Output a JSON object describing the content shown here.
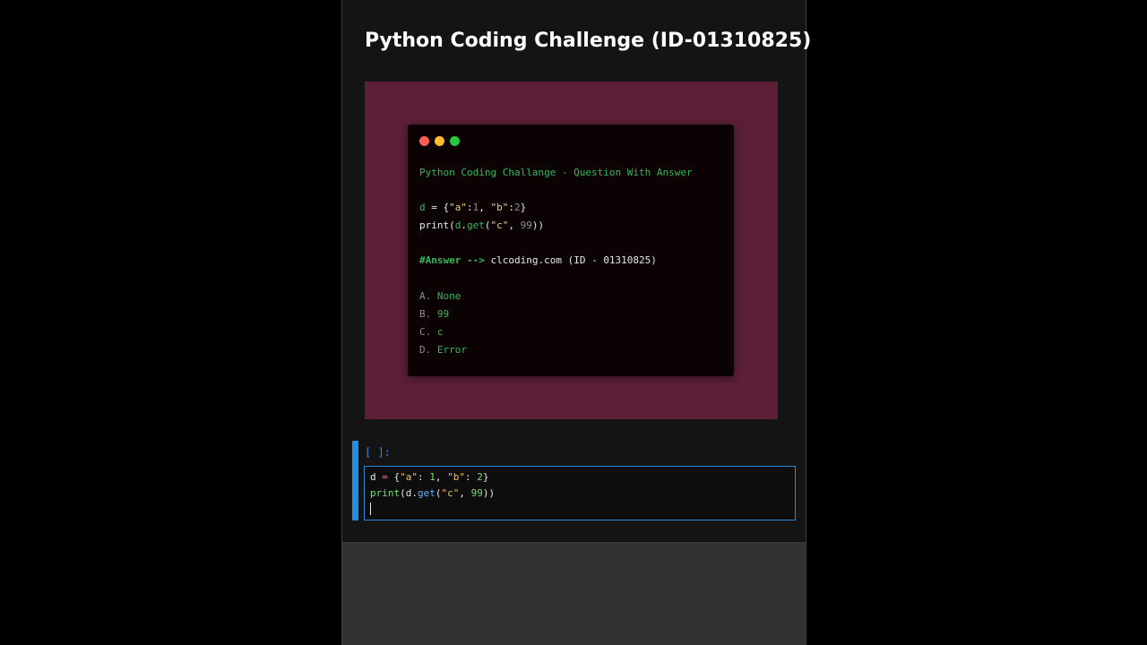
{
  "notebook": {
    "title": "Python Coding Challenge (ID-01310825)"
  },
  "snippet_card": {
    "window_dots": [
      {
        "name": "close",
        "color": "#ff5f57"
      },
      {
        "name": "minimize",
        "color": "#febc2e"
      },
      {
        "name": "maximize",
        "color": "#28c840"
      }
    ],
    "heading": "Python Coding Challange - Question With Answer",
    "code_line1": "d = {\"a\":1, \"b\":2}",
    "code_line2": "print(d.get(\"c\", 99))",
    "answer_line": "#Answer --> clcoding.com (ID - 01310825)",
    "options": [
      {
        "key": "A.",
        "text": "None"
      },
      {
        "key": "B.",
        "text": "99"
      },
      {
        "key": "C.",
        "text": "c"
      },
      {
        "key": "D.",
        "text": "Error"
      }
    ],
    "background_color": "#5c1f38"
  },
  "code_cell": {
    "prompt": "[ ]:",
    "line1": {
      "var": "d",
      "op": " = ",
      "brace_open": "{",
      "key_a": "\"a\"",
      "colon1": ": ",
      "val1": "1",
      "comma1": ", ",
      "key_b": "\"b\"",
      "colon2": ": ",
      "val2": "2",
      "brace_close": "}"
    },
    "line2": {
      "fn": "print",
      "paren_open": "(",
      "obj": "d",
      "dot": ".",
      "method": "get",
      "paren_open2": "(",
      "arg_str": "\"c\"",
      "comma": ", ",
      "arg_num": "99",
      "paren_close": "))"
    },
    "accent_color": "#1e90e8"
  }
}
